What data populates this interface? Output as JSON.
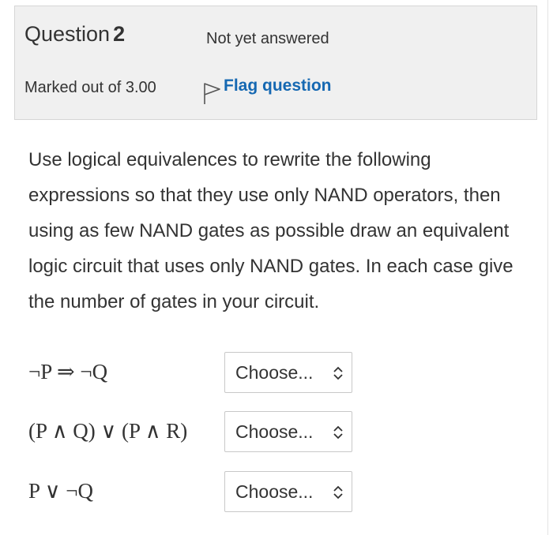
{
  "info": {
    "question_word": "Question",
    "question_number": "2",
    "state": "Not yet answered",
    "grade": "Marked out of 3.00",
    "flag_label": "Flag question"
  },
  "question_text": "Use logical equivalences to rewrite the following expressions so that they use only NAND operators, then using as few NAND gates as possible draw an equivalent logic circuit that uses only NAND gates. In each case give the number of gates in your circuit.",
  "items": [
    {
      "expression": "¬P ⇒ ¬Q",
      "selected": "Choose..."
    },
    {
      "expression": "(P ∧ Q) ∨ (P ∧ R)",
      "selected": "Choose..."
    },
    {
      "expression": "P ∨ ¬Q",
      "selected": "Choose..."
    }
  ],
  "colors": {
    "link": "#1568b2",
    "info_background": "#f0f0f0",
    "text": "#333333"
  },
  "icons": {
    "flag": "flag-outline-icon",
    "select_arrows": "up-down-chevron-icon"
  }
}
